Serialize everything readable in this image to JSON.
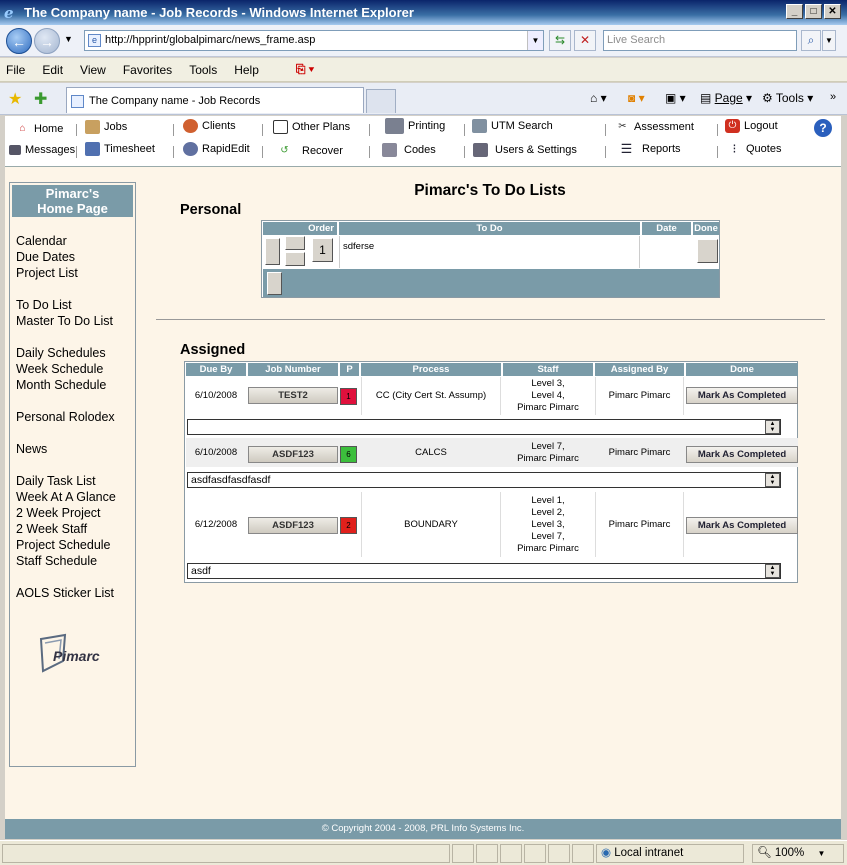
{
  "window": {
    "title": "The Company name - Job Records - Windows Internet Explorer"
  },
  "browser": {
    "address": "http://hpprint/globalpimarc/news_frame.asp",
    "search_placeholder": "Live Search",
    "menu": [
      "File",
      "Edit",
      "View",
      "Favorites",
      "Tools",
      "Help"
    ],
    "tab_title": "The Company name - Job Records",
    "page_label": "Page",
    "tools_label": "Tools",
    "status_zone": "Local intranet",
    "zoom": "100%"
  },
  "toolbar": {
    "row1": [
      {
        "label": "Home",
        "icon": "home-icon"
      },
      {
        "label": "Jobs",
        "icon": "jobs-icon"
      },
      {
        "label": "Clients",
        "icon": "clients-icon"
      },
      {
        "label": "Other Plans",
        "icon": "plans-icon"
      },
      {
        "label": "Printing",
        "icon": "printer-icon"
      },
      {
        "label": "UTM Search",
        "icon": "utm-search-icon"
      },
      {
        "label": "Assessment",
        "icon": "assessment-icon"
      },
      {
        "label": "Logout",
        "icon": "logout-icon"
      }
    ],
    "row2": [
      {
        "label": "Messages",
        "icon": "messages-icon"
      },
      {
        "label": "Timesheet",
        "icon": "timesheet-icon"
      },
      {
        "label": "RapidEdit",
        "icon": "rapidedit-icon"
      },
      {
        "label": "Recover",
        "icon": "recover-icon"
      },
      {
        "label": "Codes",
        "icon": "codes-icon"
      },
      {
        "label": "Users & Settings",
        "icon": "users-settings-icon"
      },
      {
        "label": "Reports",
        "icon": "reports-icon"
      },
      {
        "label": "Quotes",
        "icon": "quotes-icon"
      }
    ]
  },
  "sidebar": {
    "home_line1": "Pimarc's",
    "home_line2": "Home Page",
    "links": [
      "Calendar",
      "Due Dates",
      "Project List",
      "To Do List",
      "Master To Do List",
      "Daily Schedules",
      "Week Schedule",
      "Month Schedule",
      "Personal Rolodex",
      "News",
      "Daily Task List",
      "Week At A Glance",
      "2 Week Project",
      "2 Week Staff",
      "Project Schedule",
      "Staff Schedule",
      "AOLS Sticker List"
    ],
    "logo_text": "Pimarc"
  },
  "main": {
    "title": "Pimarc's To Do Lists",
    "personal": {
      "heading": "Personal",
      "headers": [
        "Order",
        "To Do",
        "Date",
        "Done"
      ],
      "rows": [
        {
          "order": "1",
          "todo": "sdferse",
          "date": ""
        }
      ]
    },
    "assigned": {
      "heading": "Assigned",
      "headers": [
        "Due By",
        "Job Number",
        "P",
        "Process",
        "Staff",
        "Assigned By",
        "Done"
      ],
      "mark_label": "Mark As Completed",
      "rows": [
        {
          "due": "6/10/2008",
          "job": "TEST2",
          "p": "1",
          "p_color": "#e0103c",
          "process": "CC (City Cert St. Assump)",
          "staff": [
            "Level 3,",
            "Level 4,",
            "Pimarc Pimarc"
          ],
          "assigned_by": "Pimarc Pimarc",
          "note": ""
        },
        {
          "due": "6/10/2008",
          "job": "ASDF123",
          "p": "6",
          "p_color": "#3cbf3c",
          "process": "CALCS",
          "staff": [
            "Level 7,",
            "Pimarc Pimarc"
          ],
          "assigned_by": "Pimarc Pimarc",
          "note": "asdfasdfasdfasdf"
        },
        {
          "due": "6/12/2008",
          "job": "ASDF123",
          "p": "2",
          "p_color": "#e0201c",
          "process": "BOUNDARY",
          "staff": [
            "Level 1,",
            "Level 2,",
            "Level 3,",
            "Level 7,",
            "Pimarc Pimarc"
          ],
          "assigned_by": "Pimarc Pimarc",
          "note": "asdf"
        }
      ]
    }
  },
  "footer": {
    "copyright": "© Copyright 2004 - 2008, PRL Info Systems Inc."
  }
}
